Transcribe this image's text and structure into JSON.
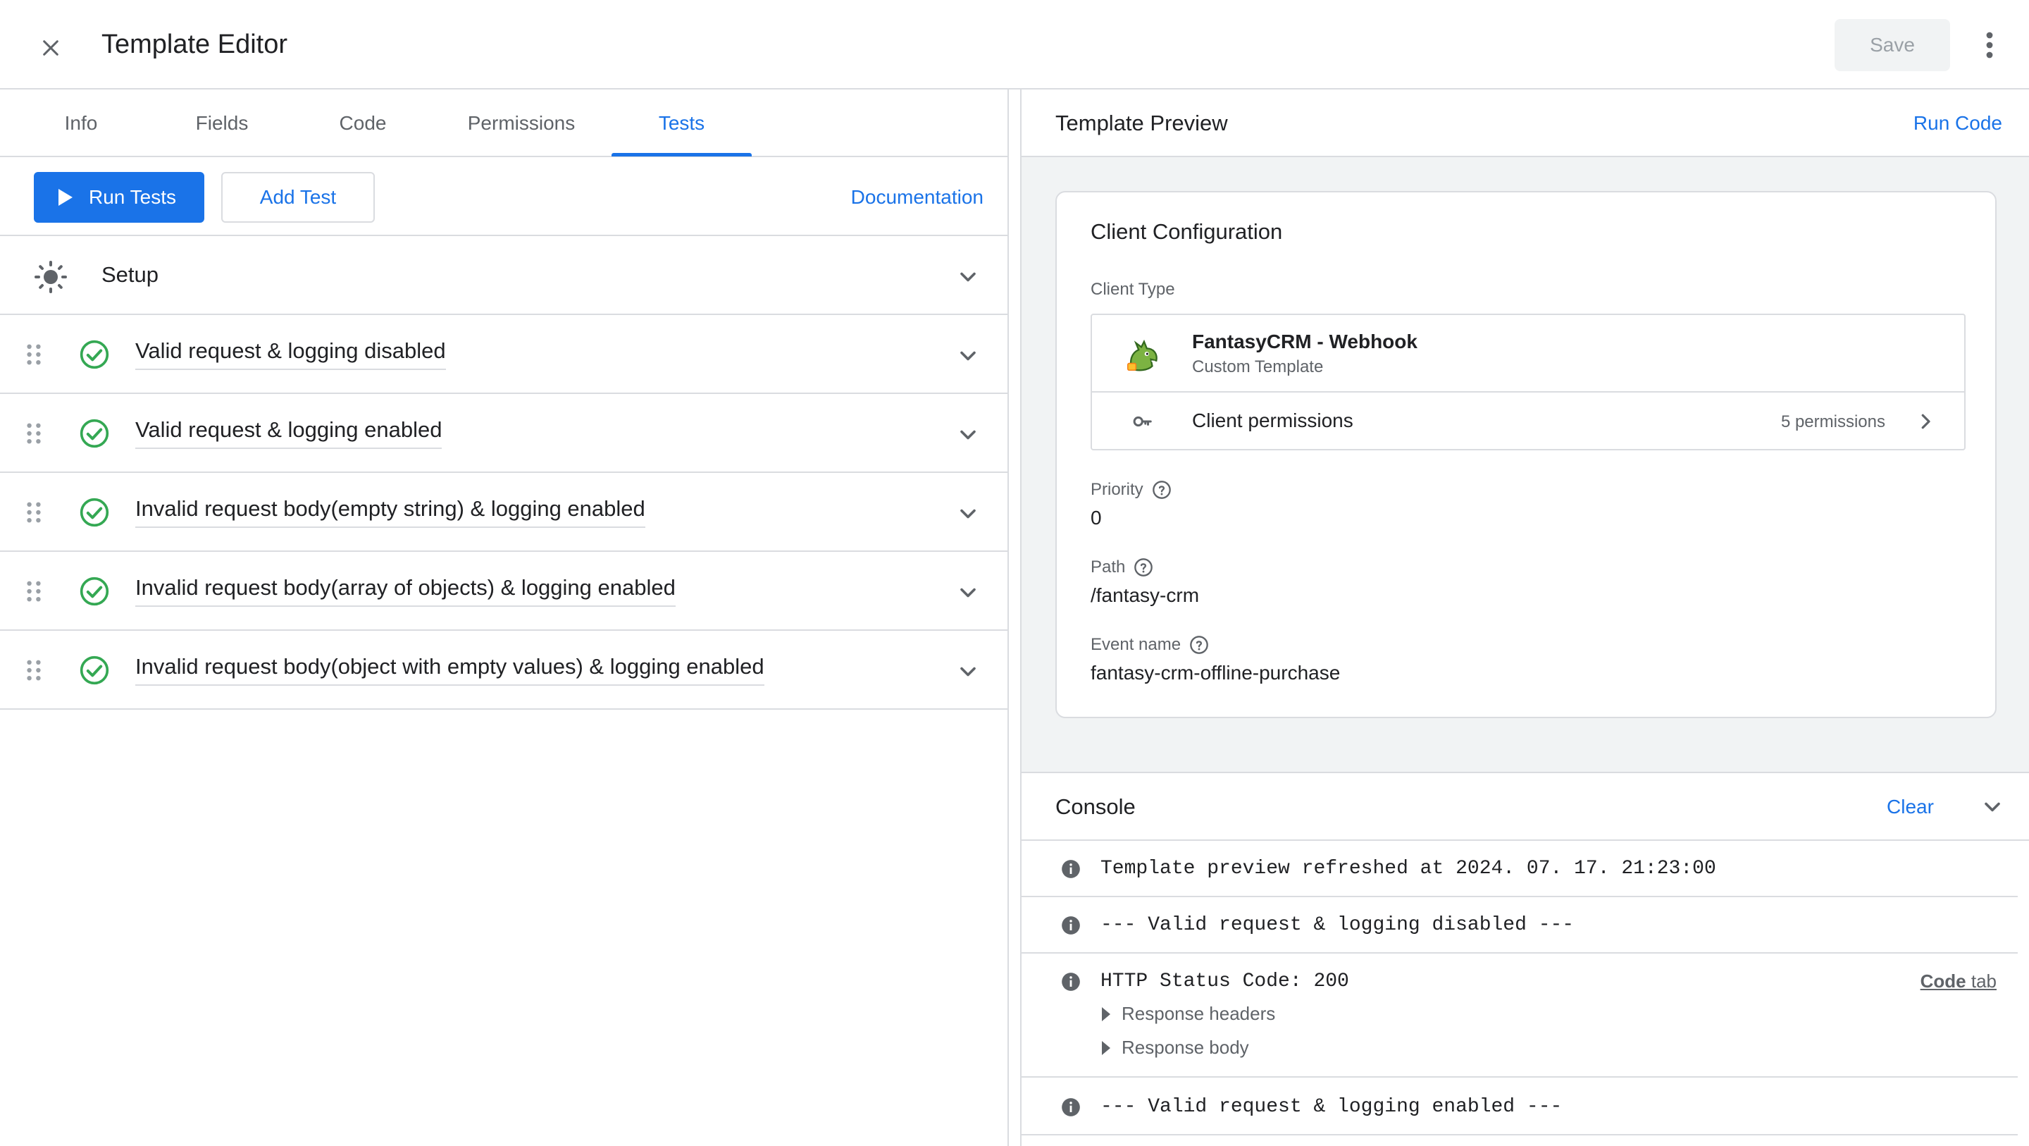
{
  "header": {
    "title": "Template Editor",
    "save_label": "Save"
  },
  "tabs": [
    {
      "label": "Info"
    },
    {
      "label": "Fields"
    },
    {
      "label": "Code"
    },
    {
      "label": "Permissions"
    },
    {
      "label": "Tests",
      "active": true
    }
  ],
  "toolbar": {
    "run_tests": "Run Tests",
    "add_test": "Add Test",
    "documentation": "Documentation"
  },
  "setup": {
    "label": "Setup"
  },
  "tests": [
    {
      "label": "Valid request & logging disabled",
      "status": "passed"
    },
    {
      "label": "Valid request & logging enabled",
      "status": "passed"
    },
    {
      "label": "Invalid request body(empty string) & logging enabled",
      "status": "passed"
    },
    {
      "label": "Invalid request body(array of objects) & logging enabled",
      "status": "passed"
    },
    {
      "label": "Invalid request body(object with empty values) & logging enabled",
      "status": "passed"
    }
  ],
  "preview": {
    "title": "Template Preview",
    "run_code": "Run Code",
    "card": {
      "title": "Client Configuration",
      "client_type_label": "Client Type",
      "client_name": "FantasyCRM - Webhook",
      "client_sub": "Custom Template",
      "permissions_label": "Client permissions",
      "permissions_count": "5 permissions",
      "priority_label": "Priority",
      "priority_value": "0",
      "path_label": "Path",
      "path_value": "/fantasy-crm",
      "event_label": "Event name",
      "event_value": "fantasy-crm-offline-purchase"
    }
  },
  "console": {
    "title": "Console",
    "clear": "Clear",
    "logs": [
      {
        "message": "Template preview refreshed at 2024. 07. 17. 21:23:00"
      },
      {
        "message": "--- Valid request & logging disabled ---"
      },
      {
        "message": "HTTP Status Code: 200",
        "link_bold": "Code",
        "link_rest": " tab",
        "sub1": "Response headers",
        "sub2": "Response body"
      },
      {
        "message": "--- Valid request & logging enabled ---"
      }
    ]
  },
  "colors": {
    "accent": "#1a73e8",
    "success": "#34a853",
    "border": "#dadce0"
  }
}
